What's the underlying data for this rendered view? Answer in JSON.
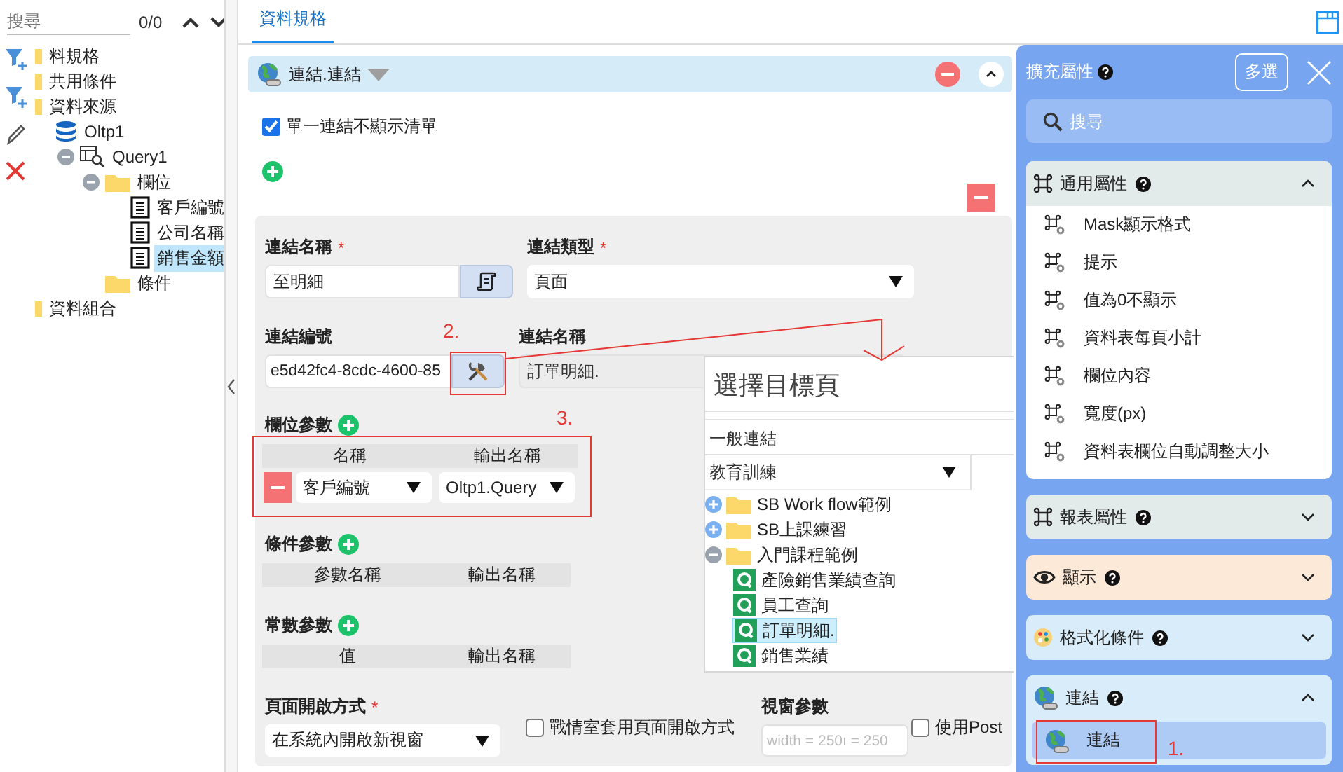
{
  "left_panel": {
    "search": {
      "placeholder": "搜尋",
      "count": "0/0"
    },
    "tools": [
      {
        "kind": "filter-add"
      },
      {
        "kind": "filter-add"
      },
      {
        "kind": "edit"
      },
      {
        "kind": "delete"
      }
    ],
    "tree": [
      {
        "label": "料規格",
        "kind": "tag",
        "selected": false
      },
      {
        "label": "共用條件",
        "kind": "tag",
        "selected": false
      },
      {
        "label": "資料來源",
        "kind": "tag",
        "selected": false,
        "children": [
          {
            "label": "Oltp1",
            "kind": "database",
            "selected": false,
            "children": [
              {
                "label": "Query1",
                "kind": "query",
                "selected": false,
                "expanded": true,
                "children": [
                  {
                    "label": "欄位",
                    "kind": "folder",
                    "selected": false,
                    "expanded": true,
                    "children": [
                      {
                        "label": "客戶編號",
                        "kind": "field",
                        "selected": false
                      },
                      {
                        "label": "公司名稱",
                        "kind": "field",
                        "selected": false
                      },
                      {
                        "label": "銷售金額",
                        "kind": "field",
                        "selected": true
                      }
                    ]
                  },
                  {
                    "label": "條件",
                    "kind": "folder",
                    "selected": false
                  }
                ]
              }
            ]
          }
        ]
      },
      {
        "label": "資料組合",
        "kind": "tag",
        "selected": false
      }
    ]
  },
  "tabs": [
    {
      "label": "資料規格",
      "selected": true
    }
  ],
  "link_block": {
    "title": "連結.連結",
    "single_link_hide_list": {
      "label": "單一連結不顯示清單",
      "checked": true
    },
    "form": {
      "link_name": {
        "label": "連結名稱",
        "required_mark": "*",
        "value": "至明細"
      },
      "link_type": {
        "label": "連結類型",
        "required_mark": "*",
        "value": "頁面"
      },
      "link_id": {
        "label": "連結編號",
        "value": "e5d42fc4-8cdc-4600-85"
      },
      "target_name": {
        "label": "連結名稱",
        "value": "訂單明細."
      },
      "field_params": {
        "label": "欄位參數",
        "columns": [
          "名稱",
          "輸出名稱"
        ],
        "rows": [
          {
            "name": "客戶編號",
            "output": "Oltp1.Query"
          }
        ]
      },
      "condition_params": {
        "label": "條件參數",
        "columns": [
          "參數名稱",
          "輸出名稱"
        ]
      },
      "constant_params": {
        "label": "常數參數",
        "columns": [
          "值",
          "輸出名稱"
        ]
      },
      "open_mode": {
        "label": "頁面開啟方式",
        "required_mark": "*",
        "value": "在系統內開啟新視窗"
      },
      "dashboard_open_mode": {
        "label": "戰情室套用頁面開啟方式",
        "checked": false
      },
      "window_params": {
        "label": "視窗參數",
        "placeholder": "width = 250ı = 250"
      },
      "use_post": {
        "label": "使用Post",
        "checked": false
      }
    }
  },
  "target_picker": {
    "title": "選擇目標頁",
    "section": "一般連結",
    "category": "教育訓練",
    "tree": [
      {
        "label": "SB Work flow範例",
        "kind": "folder",
        "expanded": false,
        "selected": false
      },
      {
        "label": "SB上課練習",
        "kind": "folder",
        "expanded": false,
        "selected": false
      },
      {
        "label": "入門課程範例",
        "kind": "folder",
        "expanded": true,
        "selected": false,
        "children": [
          {
            "label": "產險銷售業績查詢",
            "kind": "query",
            "selected": false
          },
          {
            "label": "員工查詢",
            "kind": "query",
            "selected": false
          },
          {
            "label": "訂單明細.",
            "kind": "query",
            "selected": true
          },
          {
            "label": "銷售業績",
            "kind": "query",
            "selected": false
          }
        ]
      }
    ]
  },
  "right_panel": {
    "title": "擴充屬性",
    "multi_select": "多選",
    "search": {
      "placeholder": "搜尋"
    },
    "sections": [
      {
        "title": "通用屬性",
        "kind": "command",
        "color": "#e3eaea",
        "expanded": true,
        "items": [
          {
            "label": "Mask顯示格式",
            "selected": false
          },
          {
            "label": "提示",
            "selected": false
          },
          {
            "label": "值為0不顯示",
            "selected": false
          },
          {
            "label": "資料表每頁小計",
            "selected": false
          },
          {
            "label": "欄位內容",
            "selected": false
          },
          {
            "label": "寬度(px)",
            "selected": false
          },
          {
            "label": "資料表欄位自動調整大小",
            "selected": false
          }
        ]
      },
      {
        "title": "報表屬性",
        "kind": "command",
        "color": "#e3eaea",
        "expanded": false
      },
      {
        "title": "顯示",
        "kind": "eye",
        "color": "#fde9d8",
        "expanded": false
      },
      {
        "title": "格式化條件",
        "kind": "palette",
        "color": "#d9ecf9",
        "expanded": false
      },
      {
        "title": "連結",
        "kind": "globe",
        "color": "#d9ecf9",
        "expanded": true,
        "items": [
          {
            "label": "連結",
            "selected": true
          }
        ]
      }
    ]
  },
  "annotations": [
    {
      "label": "1."
    },
    {
      "label": "2."
    },
    {
      "label": "3."
    }
  ]
}
